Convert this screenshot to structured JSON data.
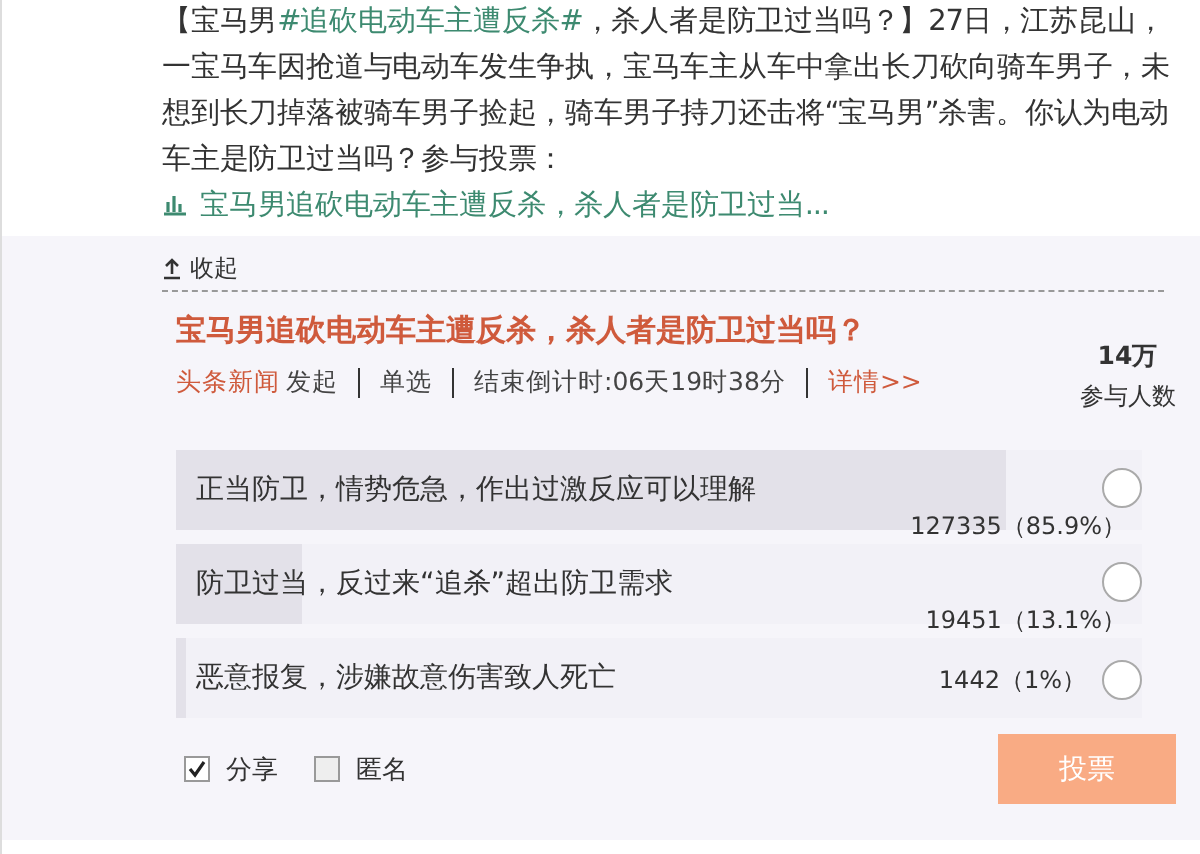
{
  "article": {
    "parts": [
      {
        "kind": "text",
        "text": "【宝马男"
      },
      {
        "kind": "tag",
        "text": "#追砍电动车主遭反杀#"
      },
      {
        "kind": "text",
        "text": "，杀人者是防卫过当吗？】27日，江苏昆山，一宝马车因抢道与电动车发生争执，宝马车主从车中拿出长刀砍向骑车男子，未想到长刀掉落被骑车男子捡起，骑车男子持刀还击将“宝马男”杀害。你认为电动车主是防卫过当吗？参与投票："
      },
      {
        "kind": "poll-link",
        "text": "宝马男追砍电动车主遭反杀，杀人者是防卫过当..."
      }
    ]
  },
  "collapse": {
    "label": "收起"
  },
  "poll": {
    "title": "宝马男追砍电动车主遭反杀，杀人者是防卫过当吗？",
    "source": "头条新闻",
    "source_suffix": "发起",
    "mode": "单选",
    "countdown": "结束倒计时:06天19时38分",
    "details": "详情>>",
    "participants": "14万",
    "participants_label": "参与人数",
    "options": [
      {
        "label": "正当防卫，情势危急，作出过激反应可以理解",
        "level": 0.859,
        "result": "127335（85.9%）",
        "selected": false
      },
      {
        "label": "防卫过当，反过来“追杀”超出防卫需求",
        "level": 0.131,
        "result": "19451（13.1%）",
        "selected": false
      },
      {
        "label": "恶意报复，涉嫌故意伤害致人死亡",
        "level": 0.01,
        "result": "1442（1%）",
        "selected": false
      }
    ],
    "toggles": [
      {
        "label": "分享",
        "checked": true
      },
      {
        "label": "匿名",
        "checked": false
      }
    ],
    "submit": {
      "label": "投票",
      "disabled": true
    }
  }
}
